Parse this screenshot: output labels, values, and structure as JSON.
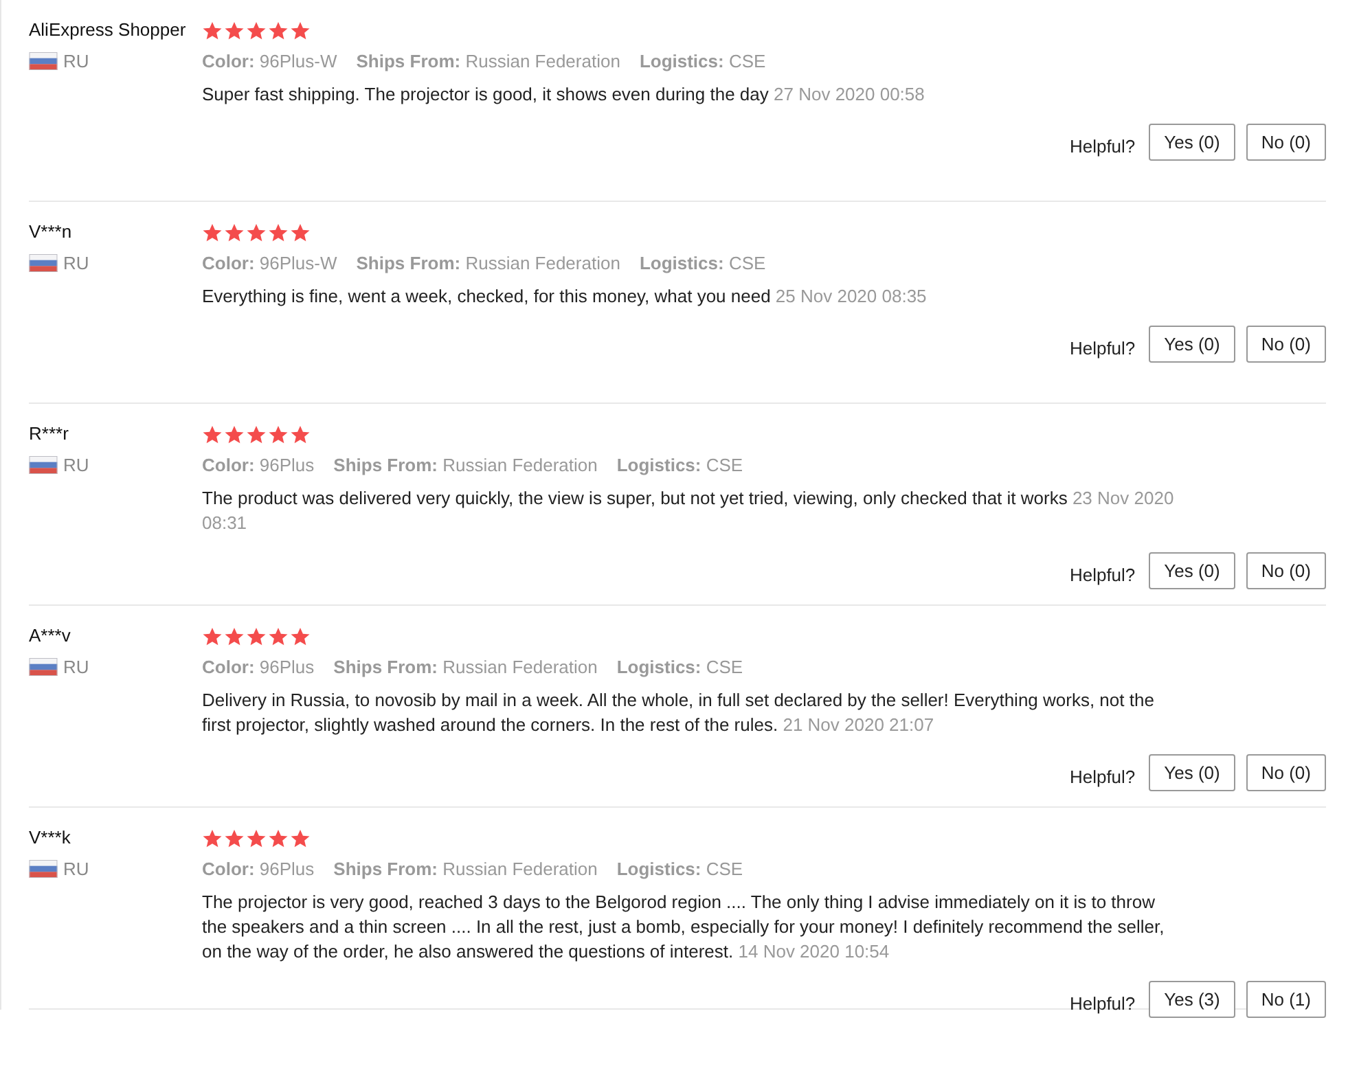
{
  "reviews": [
    {
      "user": "AliExpress Shopper",
      "country": "RU",
      "stars": 5,
      "meta": [
        {
          "label": "Color:",
          "value": "96Plus-W"
        },
        {
          "label": "Ships From:",
          "value": "Russian Federation"
        },
        {
          "label": "Logistics:",
          "value": "CSE"
        }
      ],
      "text": "Super fast shipping. The projector is good, it shows even during the day",
      "date": "27 Nov 2020 00:58",
      "helpful": "Helpful?",
      "yes": "Yes (0)",
      "no": "No (0)"
    },
    {
      "user": "V***n",
      "country": "RU",
      "stars": 5,
      "meta": [
        {
          "label": "Color:",
          "value": "96Plus-W"
        },
        {
          "label": "Ships From:",
          "value": "Russian Federation"
        },
        {
          "label": "Logistics:",
          "value": "CSE"
        }
      ],
      "text": "Everything is fine, went a week, checked, for this money, what you need",
      "date": "25 Nov 2020 08:35",
      "helpful": "Helpful?",
      "yes": "Yes (0)",
      "no": "No (0)"
    },
    {
      "user": "R***r",
      "country": "RU",
      "stars": 5,
      "meta": [
        {
          "label": "Color:",
          "value": "96Plus"
        },
        {
          "label": "Ships From:",
          "value": "Russian Federation"
        },
        {
          "label": "Logistics:",
          "value": "CSE"
        }
      ],
      "text": "The product was delivered very quickly, the view is super, but not yet tried, viewing, only checked that it works",
      "date": "23 Nov 2020 08:31",
      "helpful": "Helpful?",
      "yes": "Yes (0)",
      "no": "No (0)"
    },
    {
      "user": "A***v",
      "country": "RU",
      "stars": 5,
      "meta": [
        {
          "label": "Color:",
          "value": "96Plus"
        },
        {
          "label": "Ships From:",
          "value": "Russian Federation"
        },
        {
          "label": "Logistics:",
          "value": "CSE"
        }
      ],
      "text": "Delivery in Russia, to novosib by mail in a week. All the whole, in full set declared by the seller! Everything works, not the first projector, slightly washed around the corners. In the rest of the rules.",
      "date": "21 Nov 2020 21:07",
      "helpful": "Helpful?",
      "yes": "Yes (0)",
      "no": "No (0)"
    },
    {
      "user": "V***k",
      "country": "RU",
      "stars": 5,
      "meta": [
        {
          "label": "Color:",
          "value": "96Plus"
        },
        {
          "label": "Ships From:",
          "value": "Russian Federation"
        },
        {
          "label": "Logistics:",
          "value": "CSE"
        }
      ],
      "text": "The projector is very good, reached 3 days to the Belgorod region .... The only thing I advise immediately on it is to throw the speakers and a thin screen .... In all the rest, just a bomb, especially for your money! I definitely recommend the seller, on the way of the order, he also answered the questions of interest.",
      "date": "14 Nov 2020 10:54",
      "helpful": "Helpful?",
      "yes": "Yes (3)",
      "no": "No (1)"
    }
  ]
}
